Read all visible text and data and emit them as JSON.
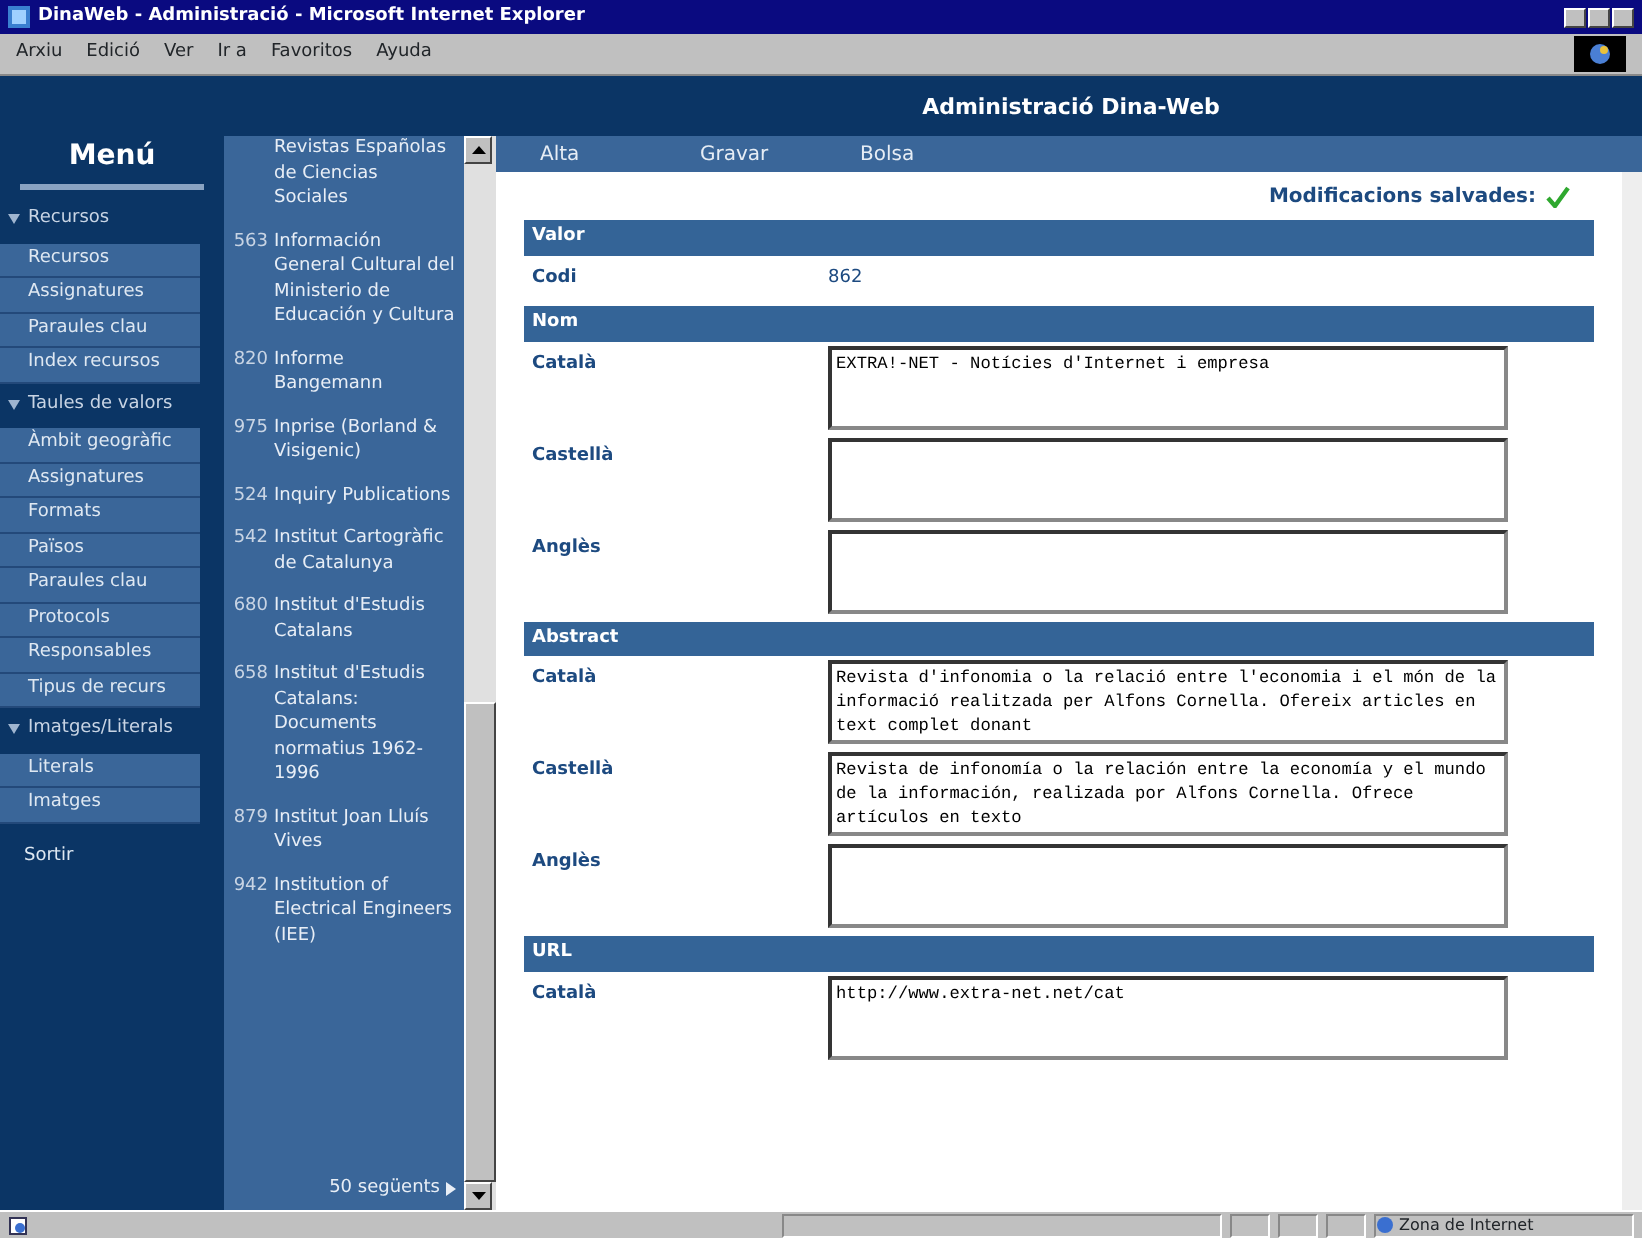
{
  "window": {
    "title": "DinaWeb - Administració - Microsoft Internet Explorer"
  },
  "menu_bar": [
    "Arxiu",
    "Edició",
    "Ver",
    "Ir a",
    "Favoritos",
    "Ayuda"
  ],
  "app_title": "Administració Dina-Web",
  "sidebar": {
    "title": "Menú",
    "groups": [
      {
        "label": "Recursos",
        "expanded": true,
        "items": [
          "Recursos",
          "Assignatures",
          "Paraules clau",
          "Index recursos"
        ]
      },
      {
        "label": "Taules de valors",
        "expanded": true,
        "items": [
          "Àmbit geogràfic",
          "Assignatures",
          "Formats",
          "Països",
          "Paraules clau",
          "Protocols",
          "Responsables",
          "Tipus de recurs"
        ]
      },
      {
        "label": "Imatges/Literals",
        "expanded": true,
        "items": [
          "Literals",
          "Imatges"
        ]
      }
    ],
    "exit": "Sortir"
  },
  "list": {
    "entries": [
      {
        "name": "Revistas Españolas de Ciencias Sociales"
      },
      {
        "code": "563",
        "name": "Información General Cultural del Ministerio de Educación y Cultura"
      },
      {
        "code": "820",
        "name": "Informe Bangemann"
      },
      {
        "code": "975",
        "name": "Inprise (Borland & Visigenic)"
      },
      {
        "code": "524",
        "name": "Inquiry Publications"
      },
      {
        "code": "542",
        "name": "Institut Cartogràfic de Catalunya"
      },
      {
        "code": "680",
        "name": "Institut d'Estudis Catalans"
      },
      {
        "code": "658",
        "name": "Institut d'Estudis Catalans: Documents normatius 1962-1996"
      },
      {
        "code": "879",
        "name": "Institut Joan Lluís Vives"
      },
      {
        "code": "942",
        "name": "Institution of Electrical Engineers (IEE)"
      }
    ],
    "more": "50 següents"
  },
  "toolbar": [
    "Alta",
    "Gravar",
    "Bolsa"
  ],
  "save_status": "Modificacions salvades:",
  "sections": [
    {
      "title": "Valor",
      "rows": [
        {
          "kind": "text",
          "label": "Codi",
          "value": "862"
        }
      ]
    },
    {
      "title": "Nom",
      "rows": [
        {
          "kind": "textarea",
          "label": "Català",
          "value": "EXTRA!-NET - Notícies d'Internet i empresa"
        },
        {
          "kind": "textarea",
          "label": "Castellà"
        },
        {
          "kind": "textarea",
          "label": "Anglès"
        }
      ]
    },
    {
      "title": "Abstract",
      "rows": [
        {
          "kind": "textarea",
          "label": "Català",
          "value": "Revista d'infonomia o la relació entre l'economia i el món de la informació realitzada per Alfons Cornella. Ofereix articles en text complet donant"
        },
        {
          "kind": "textarea",
          "label": "Castellà",
          "value": "Revista de infonomía o la relación entre la economía y el mundo de la información, realizada por Alfons Cornella. Ofrece artículos en texto"
        },
        {
          "kind": "textarea",
          "label": "Anglès"
        }
      ]
    },
    {
      "title": "URL",
      "rows": [
        {
          "kind": "textarea",
          "label": "Català",
          "value": "http://www.extra-net.net/cat"
        }
      ]
    }
  ],
  "status_bar": "Zona de Internet"
}
